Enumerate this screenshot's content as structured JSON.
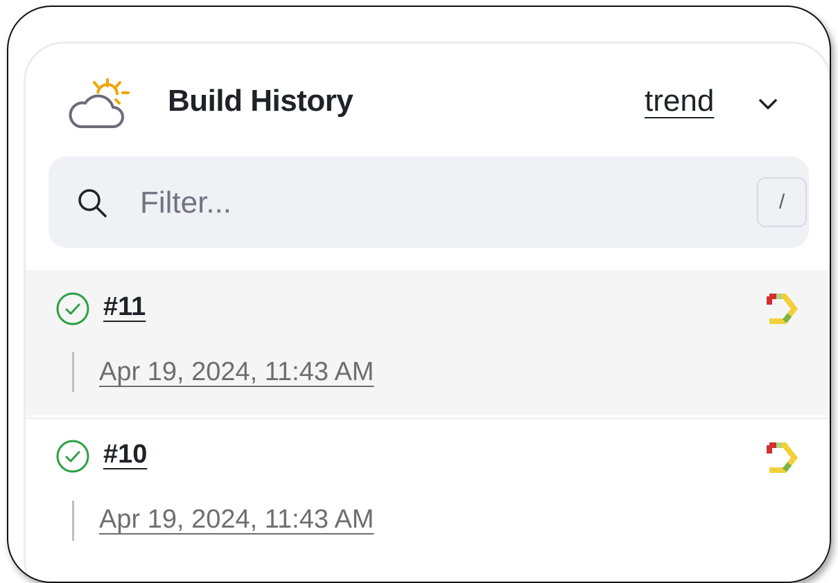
{
  "panel": {
    "title": "Build History",
    "trend_label": "trend",
    "weather_icon": "partly-cloudy-icon",
    "chevron_icon": "chevron-down-icon"
  },
  "search": {
    "placeholder": "Filter...",
    "shortcut": "/",
    "icon": "search-icon"
  },
  "builds": [
    {
      "number": "#11",
      "timestamp": "Apr 19, 2024, 11:43 AM",
      "status": "success",
      "status_icon": "check-circle-icon",
      "console_icon": "console-output-icon"
    },
    {
      "number": "#10",
      "timestamp": "Apr 19, 2024, 11:43 AM",
      "status": "success",
      "status_icon": "check-circle-icon",
      "console_icon": "console-output-icon"
    }
  ],
  "colors": {
    "success": "#2ea043",
    "sun": "#f0a500",
    "cloud": "#6b6b7a",
    "console_red": "#d32f2f",
    "console_yellow": "#f2d03a",
    "console_green": "#7cb342"
  }
}
